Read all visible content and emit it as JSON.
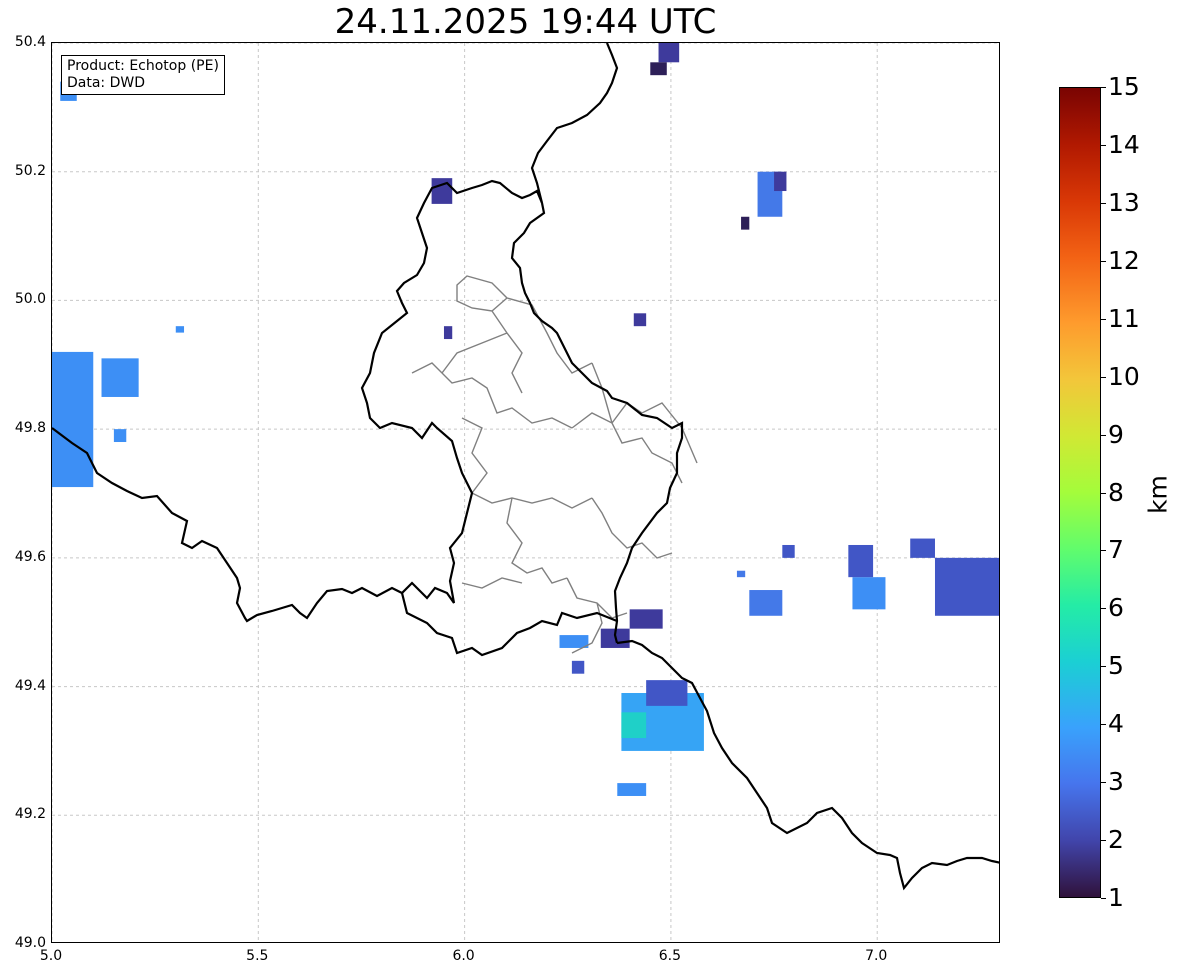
{
  "title": "24.11.2025 19:44 UTC",
  "info_box": {
    "product_line": "Product: Echotop (PE)",
    "data_line": "Data: DWD"
  },
  "axes": {
    "x_range": [
      5.0,
      7.3
    ],
    "y_range": [
      49.0,
      50.4
    ],
    "x_ticks": [
      "5.0",
      "5.5",
      "6.0",
      "6.5",
      "7.0"
    ],
    "x_tick_values": [
      5.0,
      5.5,
      6.0,
      6.5,
      7.0
    ],
    "y_ticks": [
      "49.0",
      "49.2",
      "49.4",
      "49.6",
      "49.8",
      "50.0",
      "50.2",
      "50.4"
    ],
    "y_tick_values": [
      49.0,
      49.2,
      49.4,
      49.6,
      49.8,
      50.0,
      50.2,
      50.4
    ],
    "grid": true
  },
  "colorbar": {
    "label": "km",
    "range": [
      1,
      15
    ],
    "tick_labels": [
      "1",
      "2",
      "3",
      "4",
      "5",
      "6",
      "7",
      "8",
      "9",
      "10",
      "11",
      "12",
      "13",
      "14",
      "15"
    ],
    "colormap": "turbo"
  },
  "colors": {
    "level_1_5": "#2d1f58",
    "level_2": "#3e3a9c",
    "level_2_5": "#4156c6",
    "level_3": "#4479e8",
    "level_3_5": "#3d8ff5",
    "level_4": "#36a4f5",
    "level_5": "#1fd0c8",
    "border_country": "#000000",
    "border_district": "#808080",
    "grid": "#c8c8c8"
  },
  "echo_cells": [
    {
      "lon": 6.47,
      "lat": 50.37,
      "w": 0.05,
      "h": 0.05,
      "level": "level_2"
    },
    {
      "lon": 6.45,
      "lat": 50.35,
      "w": 0.04,
      "h": 0.02,
      "level": "level_1_5"
    },
    {
      "lon": 5.02,
      "lat": 50.31,
      "w": 0.04,
      "h": 0.03,
      "level": "level_3_5"
    },
    {
      "lon": 5.92,
      "lat": 50.15,
      "w": 0.05,
      "h": 0.04,
      "level": "level_2"
    },
    {
      "lon": 6.71,
      "lat": 50.13,
      "w": 0.06,
      "h": 0.07,
      "level": "level_3"
    },
    {
      "lon": 6.75,
      "lat": 50.17,
      "w": 0.03,
      "h": 0.03,
      "level": "level_2"
    },
    {
      "lon": 6.67,
      "lat": 50.11,
      "w": 0.02,
      "h": 0.02,
      "level": "level_1_5"
    },
    {
      "lon": 6.41,
      "lat": 49.96,
      "w": 0.03,
      "h": 0.02,
      "level": "level_2"
    },
    {
      "lon": 5.95,
      "lat": 49.94,
      "w": 0.02,
      "h": 0.02,
      "level": "level_2"
    },
    {
      "lon": 5.0,
      "lat": 49.71,
      "w": 0.1,
      "h": 0.21,
      "level": "level_3_5"
    },
    {
      "lon": 5.12,
      "lat": 49.85,
      "w": 0.09,
      "h": 0.06,
      "level": "level_3_5"
    },
    {
      "lon": 5.15,
      "lat": 49.78,
      "w": 0.03,
      "h": 0.02,
      "level": "level_3_5"
    },
    {
      "lon": 5.3,
      "lat": 49.95,
      "w": 0.02,
      "h": 0.01,
      "level": "level_3_5"
    },
    {
      "lon": 6.23,
      "lat": 49.46,
      "w": 0.07,
      "h": 0.02,
      "level": "level_3_5"
    },
    {
      "lon": 6.33,
      "lat": 49.46,
      "w": 0.07,
      "h": 0.03,
      "level": "level_2"
    },
    {
      "lon": 6.4,
      "lat": 49.49,
      "w": 0.08,
      "h": 0.03,
      "level": "level_2"
    },
    {
      "lon": 6.38,
      "lat": 49.3,
      "w": 0.2,
      "h": 0.09,
      "level": "level_4"
    },
    {
      "lon": 6.44,
      "lat": 49.37,
      "w": 0.1,
      "h": 0.04,
      "level": "level_2_5"
    },
    {
      "lon": 6.38,
      "lat": 49.32,
      "w": 0.06,
      "h": 0.04,
      "level": "level_5"
    },
    {
      "lon": 6.37,
      "lat": 49.23,
      "w": 0.07,
      "h": 0.02,
      "level": "level_3_5"
    },
    {
      "lon": 6.26,
      "lat": 49.42,
      "w": 0.03,
      "h": 0.02,
      "level": "level_2_5"
    },
    {
      "lon": 6.69,
      "lat": 49.51,
      "w": 0.08,
      "h": 0.04,
      "level": "level_3"
    },
    {
      "lon": 6.94,
      "lat": 49.52,
      "w": 0.08,
      "h": 0.05,
      "level": "level_3_5"
    },
    {
      "lon": 7.14,
      "lat": 49.51,
      "w": 0.16,
      "h": 0.09,
      "level": "level_2_5"
    },
    {
      "lon": 7.08,
      "lat": 49.6,
      "w": 0.06,
      "h": 0.03,
      "level": "level_2_5"
    },
    {
      "lon": 6.93,
      "lat": 49.57,
      "w": 0.06,
      "h": 0.05,
      "level": "level_2_5"
    },
    {
      "lon": 6.77,
      "lat": 49.6,
      "w": 0.03,
      "h": 0.02,
      "level": "level_2_5"
    },
    {
      "lon": 6.66,
      "lat": 49.57,
      "w": 0.02,
      "h": 0.01,
      "level": "level_3"
    }
  ]
}
